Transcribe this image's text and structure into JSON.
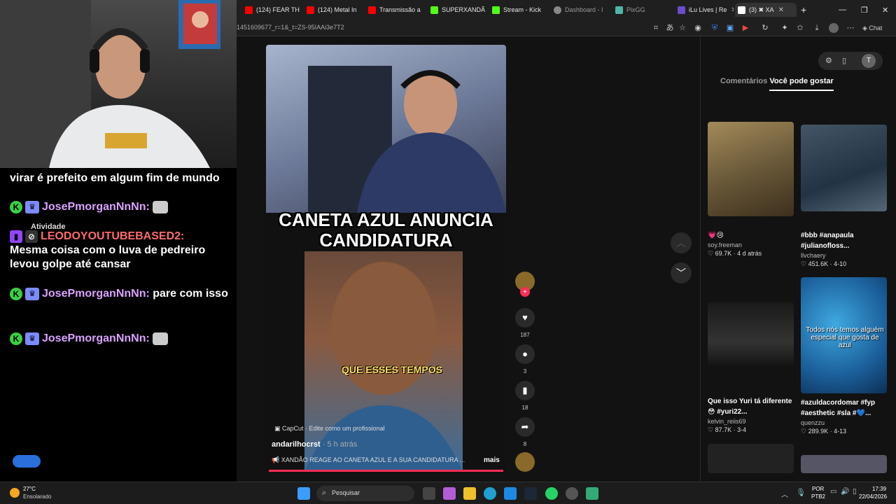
{
  "browser": {
    "tabs": [
      {
        "label": "(124) FEAR TH",
        "icon": "youtube-icon",
        "color": "#ff0000"
      },
      {
        "label": "(124) Metal In",
        "icon": "youtube-icon",
        "color": "#ff0000"
      },
      {
        "label": "Transmissão a",
        "icon": "youtube-icon",
        "color": "#ff0000"
      },
      {
        "label": "SUPERXANDÃ",
        "icon": "kick-icon",
        "color": "#53fc18"
      },
      {
        "label": "Stream - Kick",
        "icon": "kick-icon",
        "color": "#53fc18"
      },
      {
        "label": "Dashboard - I",
        "icon": "globe-icon",
        "color": "#888888"
      },
      {
        "label": "PixGG",
        "icon": "pix-icon",
        "color": "#4fb6a8"
      },
      {
        "label": "iLu Lives | Re",
        "icon": "twitch-icon",
        "color": "#6a4ccf"
      },
      {
        "label": "(3) ✖ XA",
        "icon": "tiktok-icon",
        "color": "#ffffff"
      }
    ],
    "url": "1451609677_r=1&_t=ZS-95IAAi3e7T2",
    "chat_label": "Chat"
  },
  "chat": {
    "messages": [
      {
        "user": "",
        "text": "virar é prefeito em algum fim de mundo"
      },
      {
        "user": "JosePmorganNnNn:",
        "text": ""
      },
      {
        "user": "LEODOYOUTUBEBASED2:",
        "text": "Mesma coisa com o luva de pedreiro levou golpe até cansar"
      },
      {
        "user": "JosePmorganNnNn:",
        "text": "pare com isso"
      },
      {
        "user": "JosePmorganNnNn:",
        "text": ""
      }
    ],
    "ghost_items": [
      "Atividade"
    ]
  },
  "video": {
    "caption_line1": "CANETA AZUL ANUNCIA",
    "caption_line2": "CANDIDATURA",
    "subtitle": "QUE ESSES TEMPOS",
    "capcut": "CapCut · Edite como um profissional",
    "author": "andarilhocrst",
    "time": " · 5 h atrás",
    "description": "📢 XANDÃO REAGE AO CANETA AZUL E A SUA CANDIDATURA ...",
    "more": "mais",
    "likes": "187",
    "comments": "3",
    "saves": "18",
    "shares": "8"
  },
  "sidebar": {
    "tab_comments": "Comentários",
    "tab_suggest": "Você pode gostar",
    "avatar_letter": "T",
    "cards": [
      {
        "title": "💗😢",
        "user": "soy.freeman",
        "likes": "♡ 69.7K",
        "date": "4 d atrás"
      },
      {
        "title": "#bbb #anapaula #julianofloss...",
        "user": "llvchaery",
        "likes": "♡ 451.6K",
        "date": "4-10"
      },
      {
        "title": "Que isso Yuri tá diferente 😳 #yuri22...",
        "user": "kelvin_reiis69",
        "likes": "♡ 87.7K",
        "date": "3-4"
      },
      {
        "title": "#azuldacordomar #fyp #aesthetic #sla #💙...",
        "user": "quenzzu",
        "likes": "♡ 289.9K",
        "date": "4-13"
      }
    ],
    "thumb3_text": "Todos nós temos alguém especial que gosta de azul"
  },
  "taskbar": {
    "weather_temp": "27°C",
    "weather_desc": "Ensolarado",
    "search": "Pesquisar",
    "lang": "POR",
    "lang2": "PTB2",
    "time": "17:39",
    "date": "22/04/2026"
  }
}
